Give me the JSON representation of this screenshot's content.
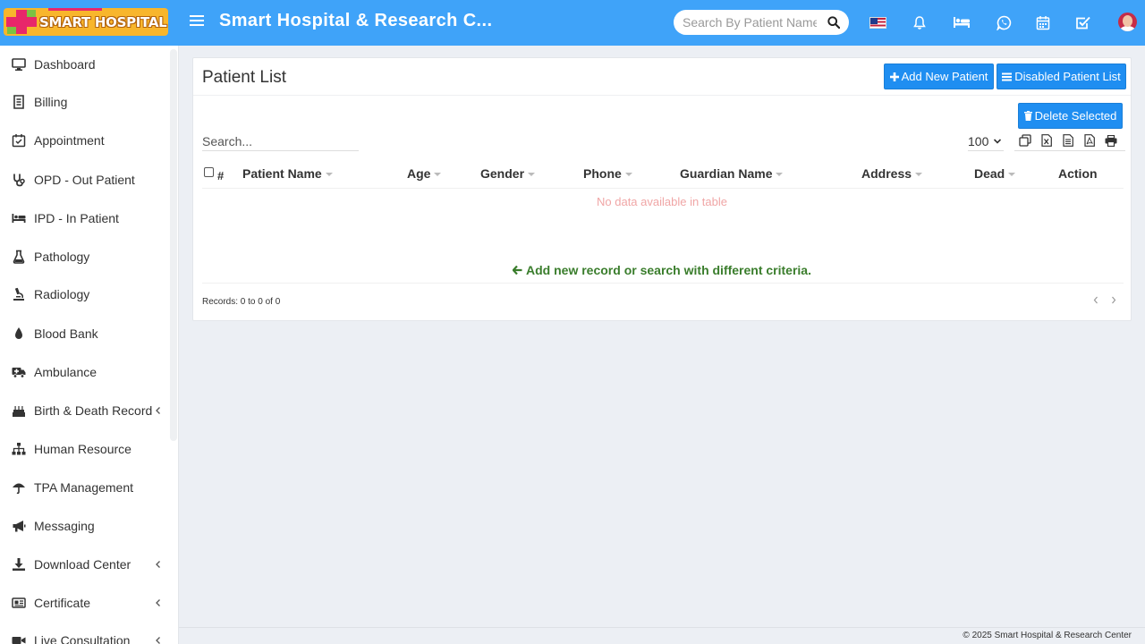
{
  "header": {
    "logo_text": "SMART HOSPITAL",
    "title": "Smart Hospital & Research C...",
    "search_placeholder": "Search By Patient Name",
    "icons": [
      "flag-us-icon",
      "bell-icon",
      "bed-icon",
      "whatsapp-icon",
      "calendar-icon",
      "task-check-icon",
      "user-avatar"
    ],
    "colors": {
      "bar": "#3fa3f9",
      "logo_bg": "#f8b62c",
      "logo_cross": "#e8276a",
      "logo_accent": "#7cc242"
    }
  },
  "sidebar": {
    "items": [
      {
        "label": "Dashboard",
        "icon": "monitor-icon"
      },
      {
        "label": "Billing",
        "icon": "receipt-icon"
      },
      {
        "label": "Appointment",
        "icon": "calendar-check-icon"
      },
      {
        "label": "OPD - Out Patient",
        "icon": "stethoscope-icon"
      },
      {
        "label": "IPD - In Patient",
        "icon": "bed-icon"
      },
      {
        "label": "Pathology",
        "icon": "flask-icon"
      },
      {
        "label": "Radiology",
        "icon": "microscope-icon"
      },
      {
        "label": "Blood Bank",
        "icon": "blood-drop-icon"
      },
      {
        "label": "Ambulance",
        "icon": "ambulance-icon"
      },
      {
        "label": "Birth & Death Record",
        "icon": "cake-icon",
        "expandable": true
      },
      {
        "label": "Human Resource",
        "icon": "sitemap-icon"
      },
      {
        "label": "TPA Management",
        "icon": "umbrella-icon"
      },
      {
        "label": "Messaging",
        "icon": "megaphone-icon"
      },
      {
        "label": "Download Center",
        "icon": "download-icon",
        "expandable": true
      },
      {
        "label": "Certificate",
        "icon": "certificate-icon",
        "expandable": true
      },
      {
        "label": "Live Consultation",
        "icon": "video-icon",
        "expandable": true
      }
    ]
  },
  "main": {
    "title": "Patient List",
    "add_button": "Add New Patient",
    "disabled_button": "Disabled Patient List",
    "delete_button": "Delete Selected",
    "search_placeholder": "Search...",
    "page_length": "100",
    "export_icons": [
      "copy-icon",
      "excel-icon",
      "csv-icon",
      "pdf-icon",
      "print-icon"
    ],
    "columns": [
      "#",
      "Patient Name",
      "Age",
      "Gender",
      "Phone",
      "Guardian Name",
      "Address",
      "Dead",
      "Action"
    ],
    "empty_text": "No data available in table",
    "add_hint": "Add new record or search with different criteria.",
    "records_text": "Records: 0 to 0 of 0",
    "colors": {
      "button": "#1f8ef1",
      "empty_text": "#f0a6a6",
      "hint": "#3a7d2c"
    }
  },
  "footer": {
    "copyright": "© 2025 Smart Hospital & Research Center"
  }
}
